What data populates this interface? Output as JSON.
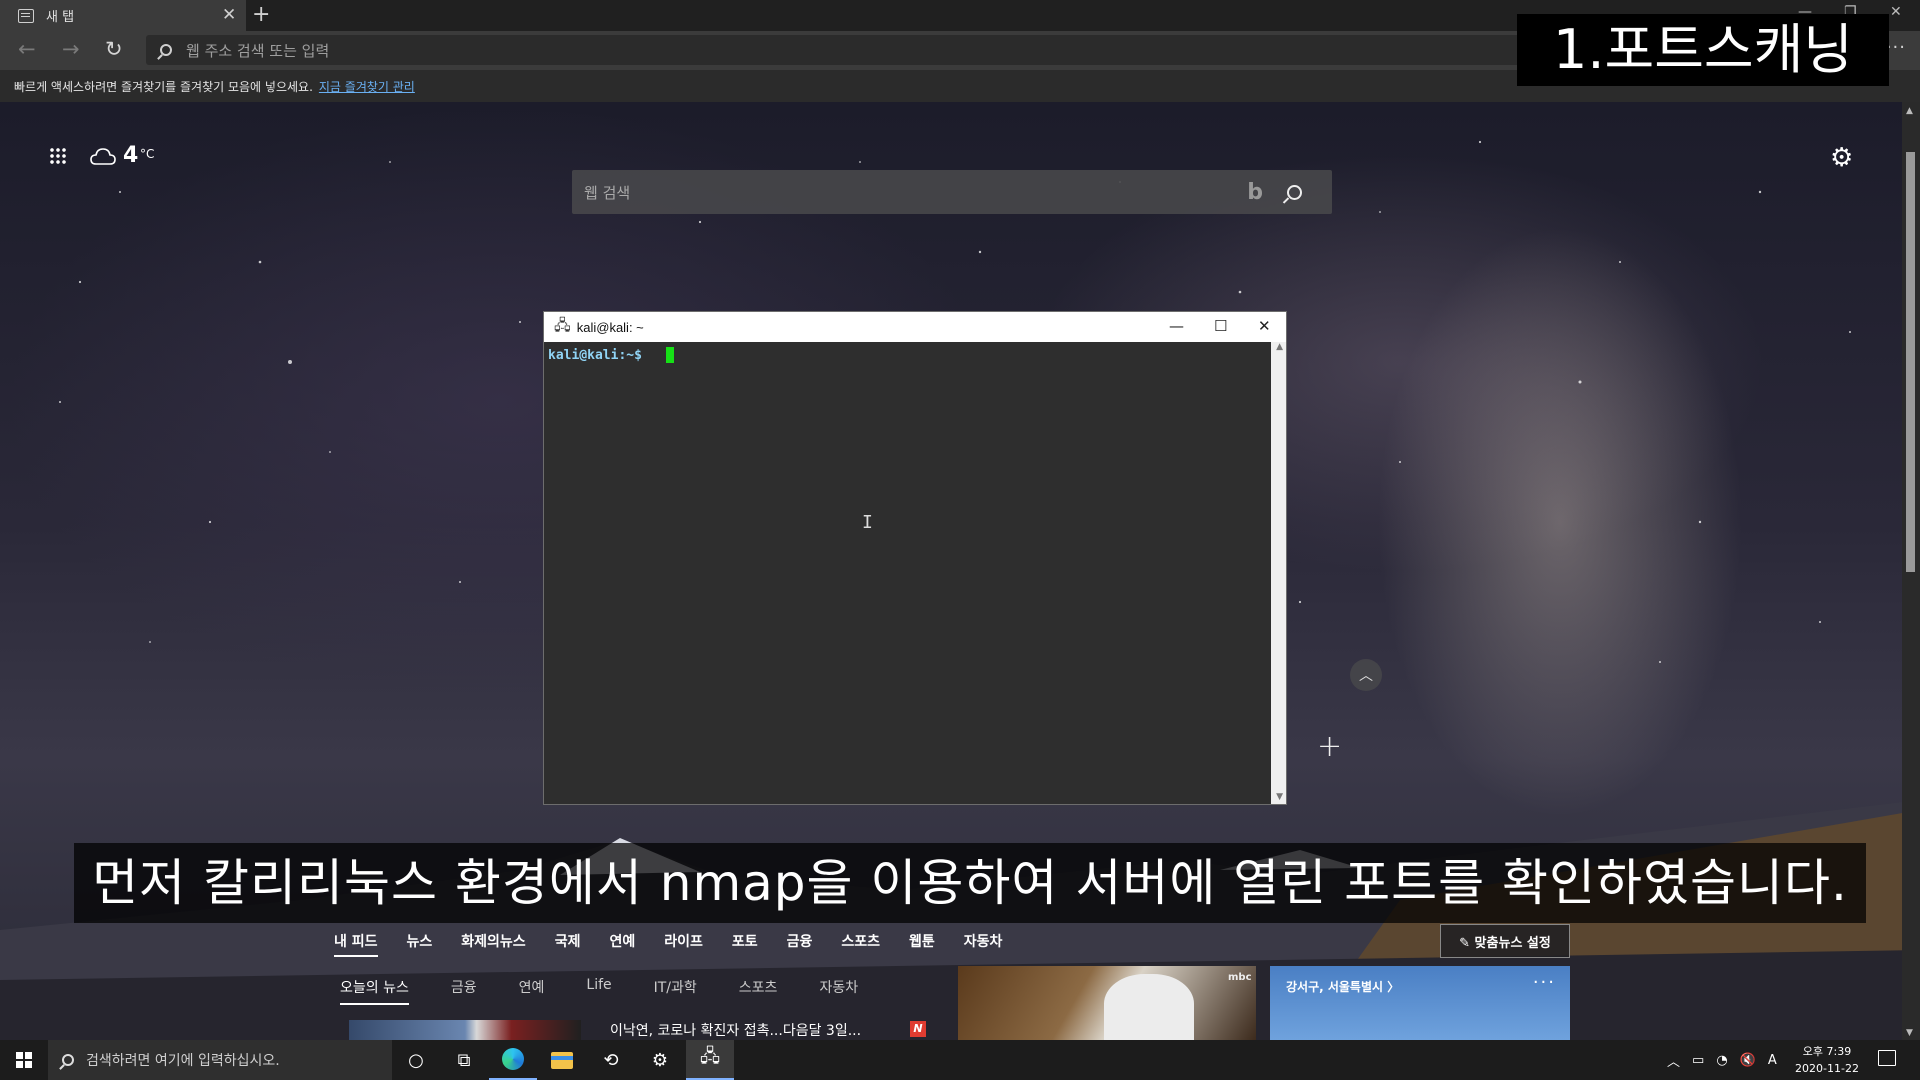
{
  "browser": {
    "tab_title": "새 탭",
    "tab_close": "✕",
    "new_tab": "+",
    "address_placeholder": "웹 주소 검색 또는 입력",
    "more": "···",
    "favorites_hint": "빠르게 액세스하려면 즐겨찾기를 즐겨찾기 모음에 넣으세요.",
    "favorites_link": "지금 즐겨찾기 관리"
  },
  "newtab": {
    "weather_temp": "4",
    "weather_unit": "°C",
    "search_placeholder": "웹 검색",
    "bing_glyph": "b",
    "scroll_top": "︿",
    "add_tile": "+"
  },
  "terminal": {
    "title": "kali@kali: ~",
    "prompt": "kali@kali:~$",
    "minimize": "—",
    "maximize": "☐",
    "close": "✕"
  },
  "overlay": {
    "title": "1.포트스캐닝",
    "subtitle": "먼저 칼리리눅스 환경에서 nmap을 이용하여 서버에 열린 포트를 확인하였습니다."
  },
  "news": {
    "tabs": [
      "내 피드",
      "뉴스",
      "화제의뉴스",
      "국제",
      "연예",
      "라이프",
      "포토",
      "금융",
      "스포츠",
      "웹툰",
      "자동차"
    ],
    "settings_button": "✎ 맞춤뉴스 설정",
    "subtabs": [
      "오늘의 뉴스",
      "금융",
      "연예",
      "Life",
      "IT/과학",
      "스포츠",
      "자동차"
    ],
    "headline": "이낙연, 코로나 확진자 접촉...다음달 3일...",
    "source_badge": "N",
    "card_source": "mbc",
    "weather_location": "강서구, 서울특별시 〉",
    "weather_more": "···"
  },
  "taskbar": {
    "search_placeholder": "검색하려면 여기에 입력하십시오.",
    "clock_time": "오후 7:39",
    "clock_date": "2020-11-22",
    "ime": "A"
  },
  "colors": {
    "terminal_prompt": "#90d4f5",
    "terminal_cursor": "#16e016",
    "link": "#6ab0f3",
    "accent": "#7fb2ff"
  }
}
